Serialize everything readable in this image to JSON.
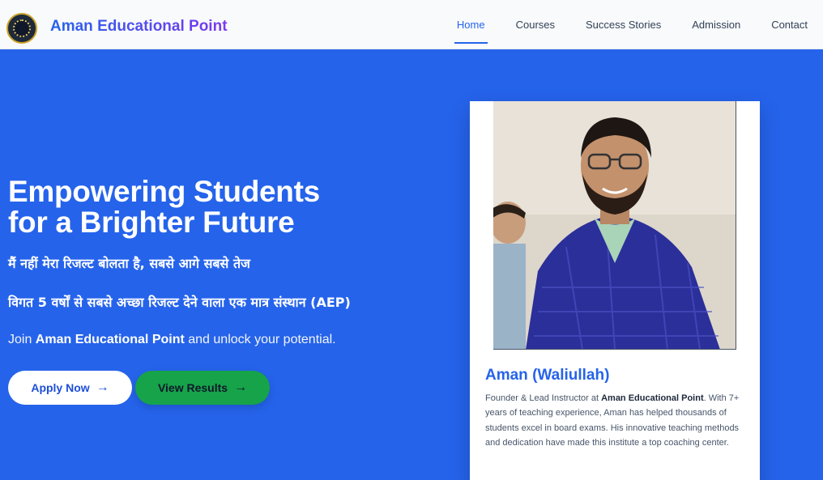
{
  "header": {
    "brand": "Aman Educational Point",
    "nav": [
      "Home",
      "Courses",
      "Success Stories",
      "Admission",
      "Contact"
    ],
    "active": "Home"
  },
  "hero": {
    "title_line1": "Empowering Students",
    "title_line2": "for a Brighter Future",
    "hindi_tagline": "मैं नहीं मेरा रिजल्ट बोलता है, सबसे आगे सबसे तेज",
    "hindi_subtitle": "विगत 5 वर्षों से सबसे अच्छा रिजल्ट देने वाला एक मात्र संस्थान (AEP)",
    "join_prefix": "Join ",
    "join_brand": "Aman Educational Point",
    "join_suffix": " and unlock your potential.",
    "apply_label": "Apply Now",
    "results_label": "View Results"
  },
  "founder": {
    "name": "Aman (Waliullah)",
    "desc_prefix": "Founder & Lead Instructor at ",
    "desc_brand": "Aman Educational Point",
    "desc_suffix": ". With 7+ years of teaching experience, Aman has helped thousands of students excel in board exams. His innovative teaching methods and dedication have made this institute a top coaching center."
  },
  "icons": {
    "arrow": "arrow-right-icon",
    "logo": "logo-emblem"
  },
  "colors": {
    "primary": "#2563eb",
    "success": "#16a34a",
    "nav_bg": "#f8fafc"
  }
}
